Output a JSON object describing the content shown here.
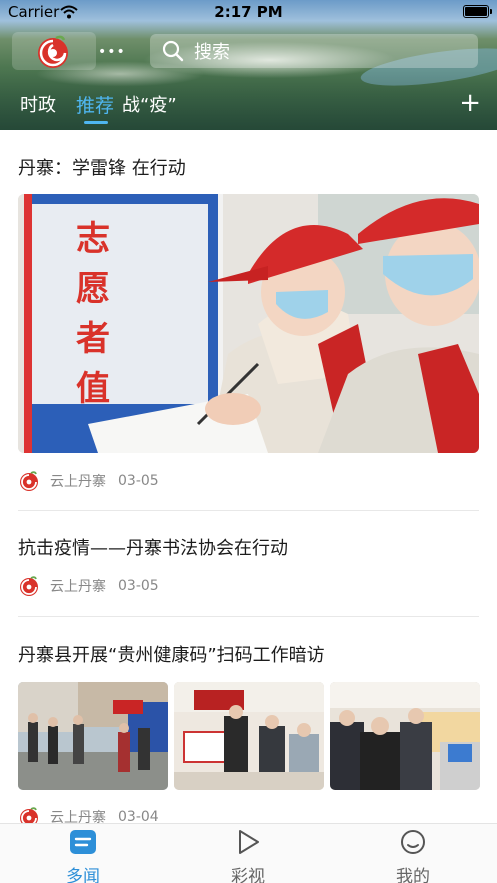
{
  "status_bar": {
    "carrier": "Carrier",
    "time": "2:17 PM"
  },
  "header": {
    "search_placeholder": "搜索",
    "tabs": [
      {
        "label": "时政",
        "active": false
      },
      {
        "label": "推荐",
        "active": true
      },
      {
        "label": "战“疫”",
        "active": false
      }
    ],
    "add_label": "+"
  },
  "articles": [
    {
      "title": "丹寨：学雷锋 在行动",
      "source": "云上丹寨",
      "date": "03-05",
      "image_sign": [
        "志",
        "愿",
        "者",
        "值"
      ]
    },
    {
      "title": "抗击疫情——丹寨书法协会在行动",
      "source": "云上丹寨",
      "date": "03-05"
    },
    {
      "title": "丹寨县开展“贵州健康码”扫码工作暗访",
      "source": "云上丹寨",
      "date": "03-04"
    }
  ],
  "bottom_tabs": [
    {
      "label": "多闻",
      "icon": "news-icon",
      "active": true
    },
    {
      "label": "彩视",
      "icon": "play-icon",
      "active": false
    },
    {
      "label": "我的",
      "icon": "profile-icon",
      "active": false
    }
  ],
  "colors": {
    "accent": "#2d8fd8",
    "tab_active": "#4fb6f0",
    "brand_red": "#d9322a"
  }
}
